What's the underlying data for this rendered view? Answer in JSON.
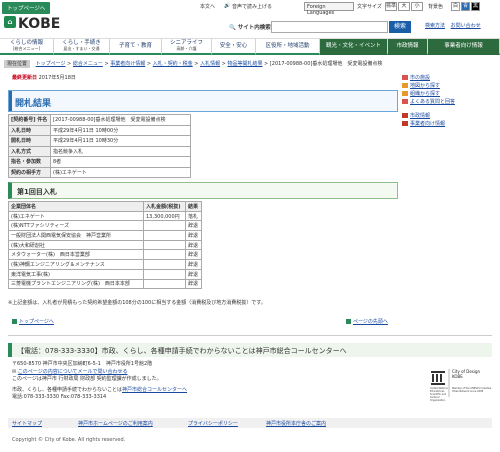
{
  "util": {
    "to_top": "トップページへ",
    "body_link": "本文へ",
    "read_aloud": "音声で読み上げる",
    "language": "Foreign Languages",
    "text_size_label": "文字サイズ",
    "size_standard": "標準",
    "size_large": "大",
    "size_small": "小",
    "bg_label": "背景色",
    "bg_white": "白",
    "bg_blue": "青",
    "bg_black": "黒"
  },
  "header": {
    "logo_text": "KOBE",
    "search_label": "サイト内検索",
    "search_button": "検索",
    "links": [
      "検索方法",
      "お問い合わせ"
    ]
  },
  "nav": [
    {
      "label": "くらしの情報",
      "sub": "[総合メニュー]",
      "dark": false
    },
    {
      "label": "くらし・手続き",
      "sub": "届出・すまい・交通",
      "dark": false
    },
    {
      "label": "子育て・教育",
      "sub": "",
      "dark": false
    },
    {
      "label": "シニアライフ",
      "sub": "高齢・介護",
      "dark": false
    },
    {
      "label": "安全・安心",
      "sub": "",
      "dark": false
    },
    {
      "label": "区役所・地域活動",
      "sub": "",
      "dark": false
    },
    {
      "label": "観光・文化・イベント",
      "sub": "",
      "dark": true
    },
    {
      "label": "市政情報",
      "sub": "",
      "dark": true
    },
    {
      "label": "事業者向け情報",
      "sub": "",
      "dark": true
    }
  ],
  "breadcrumb": {
    "current_label": "現在位置",
    "items": [
      "トップページ",
      "総合メニュー",
      "事業者向け情報",
      "入札・契約・税金",
      "入札情報",
      "物品等開札結果",
      "[2017-00988-00]垂水処理場他　受変電設備点検"
    ]
  },
  "updated": {
    "label": "最終更新日",
    "date": "2017年5月18日"
  },
  "side": {
    "items": [
      "市の施設",
      "地図から探す",
      "組織から探す",
      "よくある質問と回答"
    ],
    "items2": [
      "市政情報",
      "事業者向け情報"
    ]
  },
  "title": "開札結果",
  "info_rows": [
    {
      "label": "[契約番号] 件名",
      "value": "[2017-00988-00]垂水処理場他　受変電設備点検"
    },
    {
      "label": "入札日時",
      "value": "平成29年4月11日 10時00分"
    },
    {
      "label": "開札日時",
      "value": "平成29年4月11日 10時30分"
    },
    {
      "label": "入札方式",
      "value": "指名競争入札"
    },
    {
      "label": "指名・参加数",
      "value": "8者"
    },
    {
      "label": "契約の相手方",
      "value": "(株)エネゲート"
    }
  ],
  "section_title": "第1回目入札",
  "result": {
    "headers": [
      "企業団体名",
      "入札金額(税抜)",
      "結果"
    ],
    "rows": [
      [
        "(株)エネゲート",
        "13,300,000円",
        "落札"
      ],
      [
        "(株)NTTファシリティーズ",
        "",
        "辞退"
      ],
      [
        "一般財団法人関西電気保安協会　神戸営業所",
        "",
        "辞退"
      ],
      [
        "(株)大和研創社",
        "",
        "辞退"
      ],
      [
        "メタウォーター(株)　西日本営業部",
        "",
        "辞退"
      ],
      [
        "(株)神鋼エンジニアリング＆メンテナンス",
        "",
        "辞退"
      ],
      [
        "東洋電気工事(株)",
        "",
        "辞退"
      ],
      [
        "三菱電機プラントエンジニアリング(株)　西日本本部",
        "",
        "辞退"
      ]
    ]
  },
  "note": "※上記金額は、入札者が見積もった契約希望金額の108分の100に相当する金額（消費税及び地方消費税抜）です。",
  "pagenav": {
    "to_top": "トップページへ",
    "page_top": "ページの先頭へ"
  },
  "call_center": "【電話：078-333-3330】市政、くらし、各種申請手続でわからないことは神戸市総合コールセンターへ",
  "address": {
    "line1": "〒650-8570 神戸市中央区加納町6-5-1　神戸市役所1号館2階",
    "line2": "このページの内容についてメールで問い合わせる",
    "line3": "このページは神戸市 行財政局 財政部 契約監理課が作成しました。",
    "line4_prefix": "市政、くらし、各種申請手続でわからないことは",
    "line4_link": "神戸市総合コールセンターへ",
    "line5": "電話:078-333-3330 Fax:078-333-3314"
  },
  "unesco": {
    "org": "United Nations Educational, Scientific and Cultural Organization",
    "city": "City of Design KOBE",
    "network": "Member of the UNESCO Creative Cities Network since 2008"
  },
  "footer_links": [
    "サイトマップ",
    "神戸市ホームページのご利用案内",
    "プライバシーポリシー",
    "神戸市役所本庁舎のご案内"
  ],
  "copyright": "Copyright © City of Kobe. All rights reserved.",
  "colors": {
    "brand_green": "#2a8a5a",
    "dark_green": "#2d6a3e",
    "title_blue": "#2a6cb0",
    "link": "#1a4aa0"
  }
}
